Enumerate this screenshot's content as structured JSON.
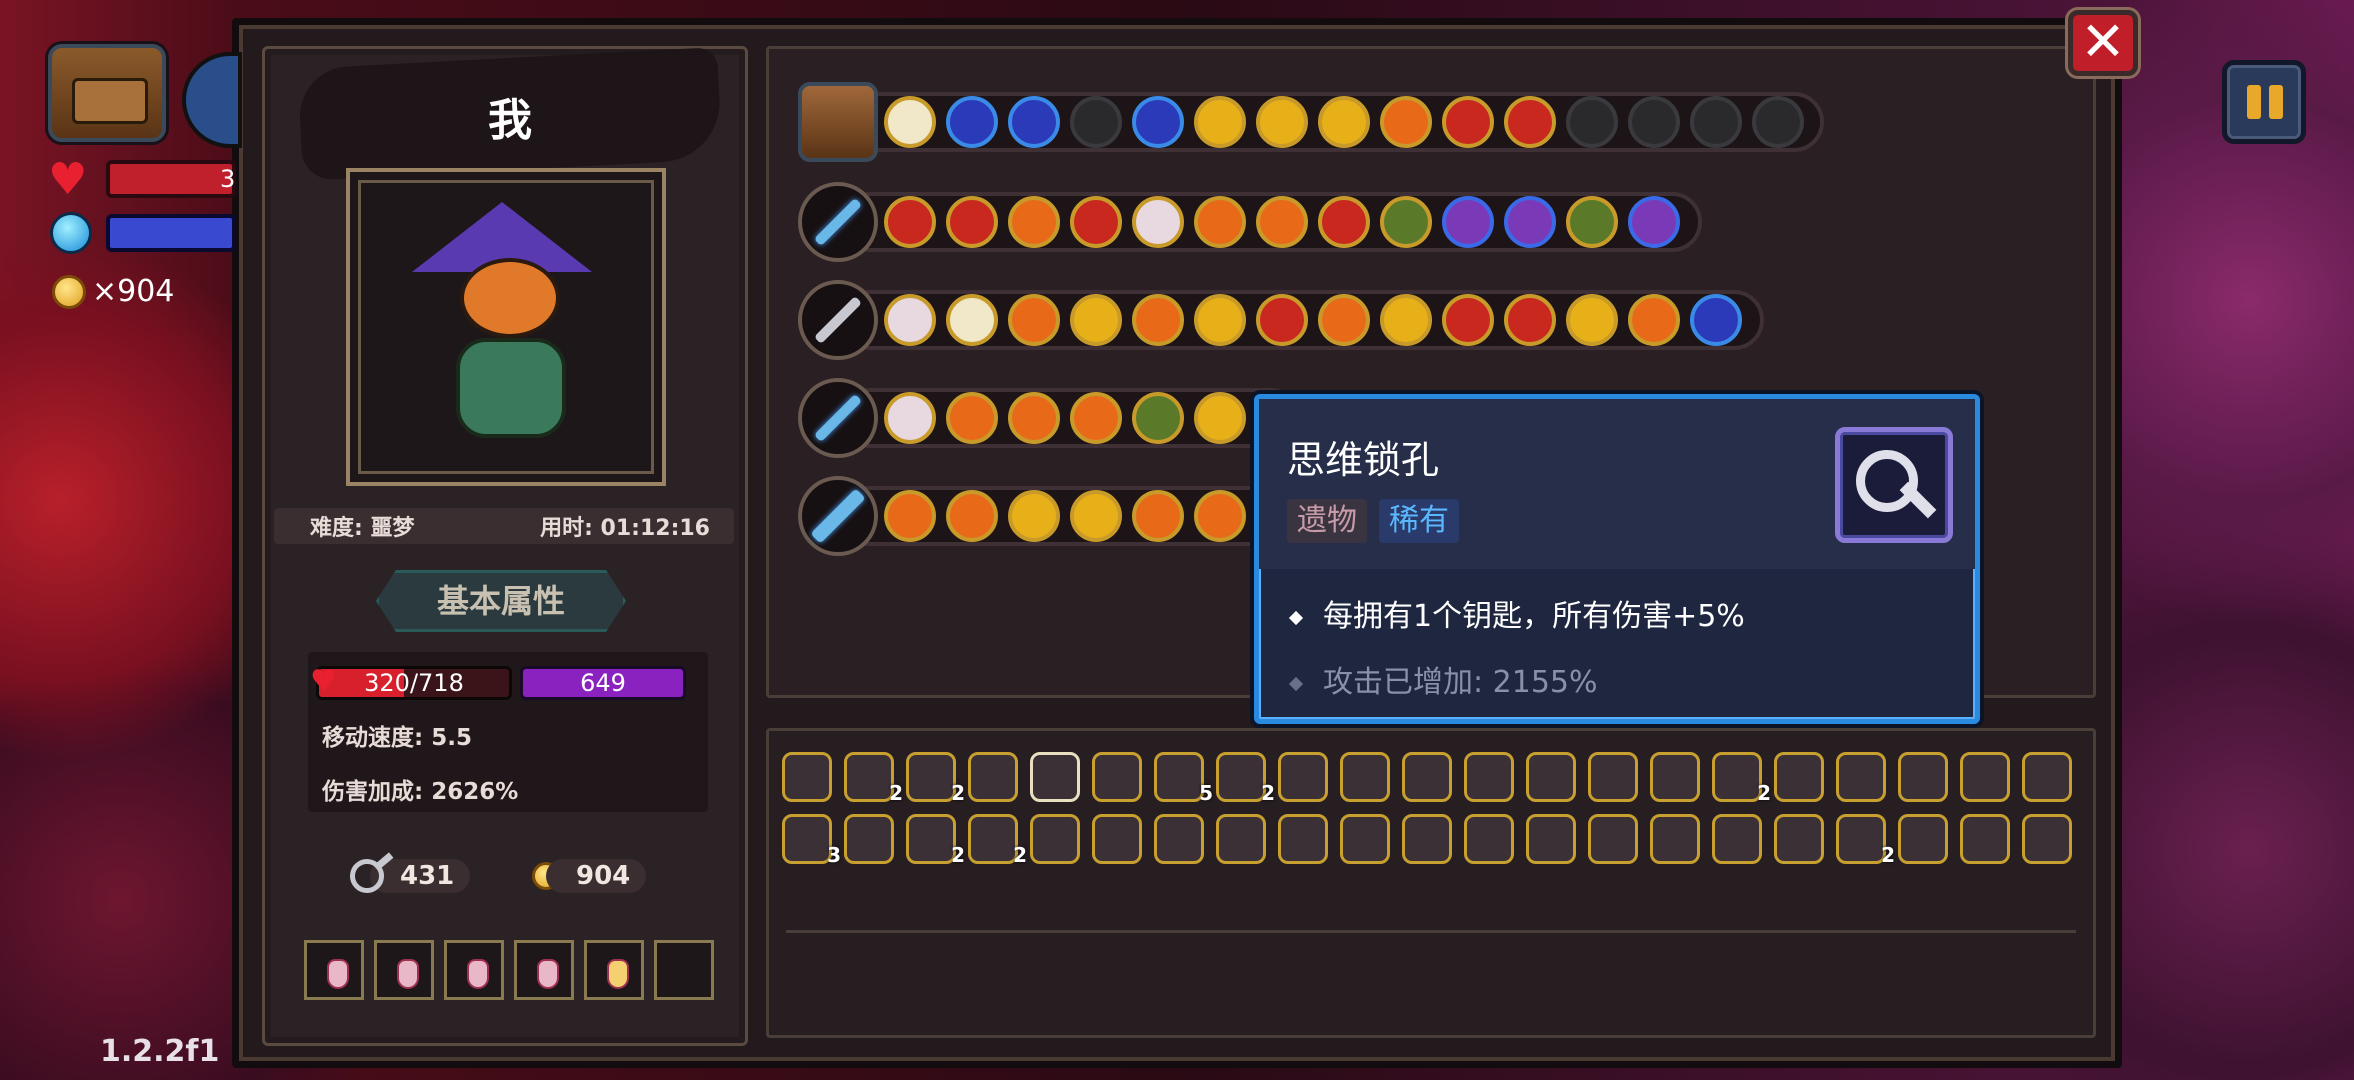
{
  "hud": {
    "hp_text": "3",
    "coins": "×904",
    "version": "1.2.2f1"
  },
  "buttons": {
    "close": "✕"
  },
  "character": {
    "name": "我",
    "difficulty": "难度: 噩梦",
    "time": "用时: 01:12:16",
    "section_title": "基本属性",
    "hp": "320/718",
    "hp_fraction": 0.446,
    "shield": "649",
    "move_speed": "移动速度: 5.5",
    "damage_bonus": "伤害加成: 2626%",
    "keys": "431",
    "gold": "904"
  },
  "tooltip": {
    "title": "思维锁孔",
    "tag_type": "遗物",
    "tag_rarity": "稀有",
    "effect": "每拥有1个钥匙，所有伤害+5%",
    "bonus": "攻击已增加: 2155%"
  },
  "colors": {
    "accent": "#2a8ae0",
    "rare": "#5ab8ff",
    "hp": "#d8202c",
    "shield": "#8a22c0"
  },
  "inventory_counts": {
    "i2": "2",
    "i3": "2",
    "i7": "5",
    "i8": "2",
    "i27": "2",
    "i31": "3",
    "i34": "2",
    "i35": "2",
    "i56": "2"
  }
}
